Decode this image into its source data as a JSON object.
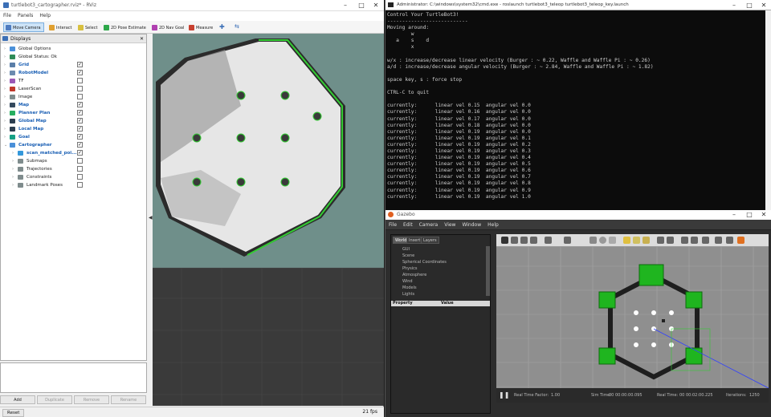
{
  "rviz": {
    "title": "turtlebot3_cartographer.rviz* - RViz",
    "menu": [
      "File",
      "Panels",
      "Help"
    ],
    "tools": [
      "Move Camera",
      "Interact",
      "Select",
      "2D Pose Estimate",
      "2D Nav Goal",
      "Measure"
    ],
    "displays_title": "Displays",
    "items": [
      {
        "label": "Global Options",
        "check": null,
        "blue": false,
        "color": "#4a90d9"
      },
      {
        "label": "Global Status: Ok",
        "check": null,
        "blue": false,
        "color": "#2e8b57"
      },
      {
        "label": "Grid",
        "check": true,
        "blue": true,
        "color": "#5a7ea8"
      },
      {
        "label": "RobotModel",
        "check": true,
        "blue": true,
        "color": "#6b8bb0"
      },
      {
        "label": "TF",
        "check": false,
        "blue": false,
        "color": "#9b59b6"
      },
      {
        "label": "LaserScan",
        "check": false,
        "blue": false,
        "color": "#c0392b"
      },
      {
        "label": "Image",
        "check": false,
        "blue": false,
        "color": "#7f8c8d"
      },
      {
        "label": "Map",
        "check": true,
        "blue": true,
        "color": "#34495e"
      },
      {
        "label": "Planner Plan",
        "check": true,
        "blue": true,
        "color": "#27ae60"
      },
      {
        "label": "Global Map",
        "check": true,
        "blue": true,
        "color": "#2c3e50"
      },
      {
        "label": "Local Map",
        "check": true,
        "blue": true,
        "color": "#2c3e50"
      },
      {
        "label": "Goal",
        "check": true,
        "blue": true,
        "color": "#16a085"
      },
      {
        "label": "Cartographer",
        "check": true,
        "blue": true,
        "color": "#4a90d9"
      },
      {
        "label": "scan_matched_poi...",
        "check": true,
        "blue": true,
        "color": "#3498db"
      },
      {
        "label": "Submaps",
        "check": false,
        "blue": false,
        "color": "#7f8c8d"
      },
      {
        "label": "Trajectories",
        "check": false,
        "blue": false,
        "color": "#7f8c8d"
      },
      {
        "label": "Constraints",
        "check": false,
        "blue": false,
        "color": "#7f8c8d"
      },
      {
        "label": "Landmark Poses",
        "check": false,
        "blue": false,
        "color": "#7f8c8d"
      }
    ],
    "buttons": [
      "Add",
      "Duplicate",
      "Remove",
      "Rename"
    ],
    "reset": "Reset",
    "fps": "21 fps"
  },
  "cmd": {
    "title": "Administrator: C:\\windows\\system32\\cmd.exe - roslaunch  turtlebot3_teleop turtlebot3_teleop_key.launch",
    "lines": [
      "Control Your TurtleBot3!",
      "---------------------------",
      "Moving around:",
      "        w",
      "   a    s    d",
      "        x",
      "",
      "w/x : increase/decrease linear velocity (Burger : ~ 0.22, Waffle and Waffle Pi : ~ 0.26)",
      "a/d : increase/decrease angular velocity (Burger : ~ 2.84, Waffle and Waffle Pi : ~ 1.82)",
      "",
      "space key, s : force stop",
      "",
      "CTRL-C to quit",
      "",
      "currently:      linear vel 0.15  angular vel 0.0",
      "currently:      linear vel 0.16  angular vel 0.0",
      "currently:      linear vel 0.17  angular vel 0.0",
      "currently:      linear vel 0.18  angular vel 0.0",
      "currently:      linear vel 0.19  angular vel 0.0",
      "currently:      linear vel 0.19  angular vel 0.1",
      "currently:      linear vel 0.19  angular vel 0.2",
      "currently:      linear vel 0.19  angular vel 0.3",
      "currently:      linear vel 0.19  angular vel 0.4",
      "currently:      linear vel 0.19  angular vel 0.5",
      "currently:      linear vel 0.19  angular vel 0.6",
      "currently:      linear vel 0.19  angular vel 0.7",
      "currently:      linear vel 0.19  angular vel 0.8",
      "currently:      linear vel 0.19  angular vel 0.9",
      "currently:      linear vel 0.19  angular vel 1.0"
    ]
  },
  "gazebo": {
    "title": "Gazebo",
    "menu": [
      "File",
      "Edit",
      "Camera",
      "View",
      "Window",
      "Help"
    ],
    "tabs": [
      "World",
      "Insert",
      "Layers"
    ],
    "world_items": [
      "GUI",
      "Scene",
      "Spherical Coordinates",
      "Physics",
      "Atmosphere",
      "Wind",
      "Models",
      "Lights"
    ],
    "prop_header": [
      "Property",
      "Value"
    ],
    "bottom": {
      "rtf_label": "Real Time Factor:",
      "rtf": "1.00",
      "sim_label": "Sim Time:",
      "sim": "00 00:00:00.095",
      "real_label": "Real Time:",
      "real": "00 00:02:00.225",
      "iter_label": "Iterations:",
      "iter": "1250"
    }
  }
}
